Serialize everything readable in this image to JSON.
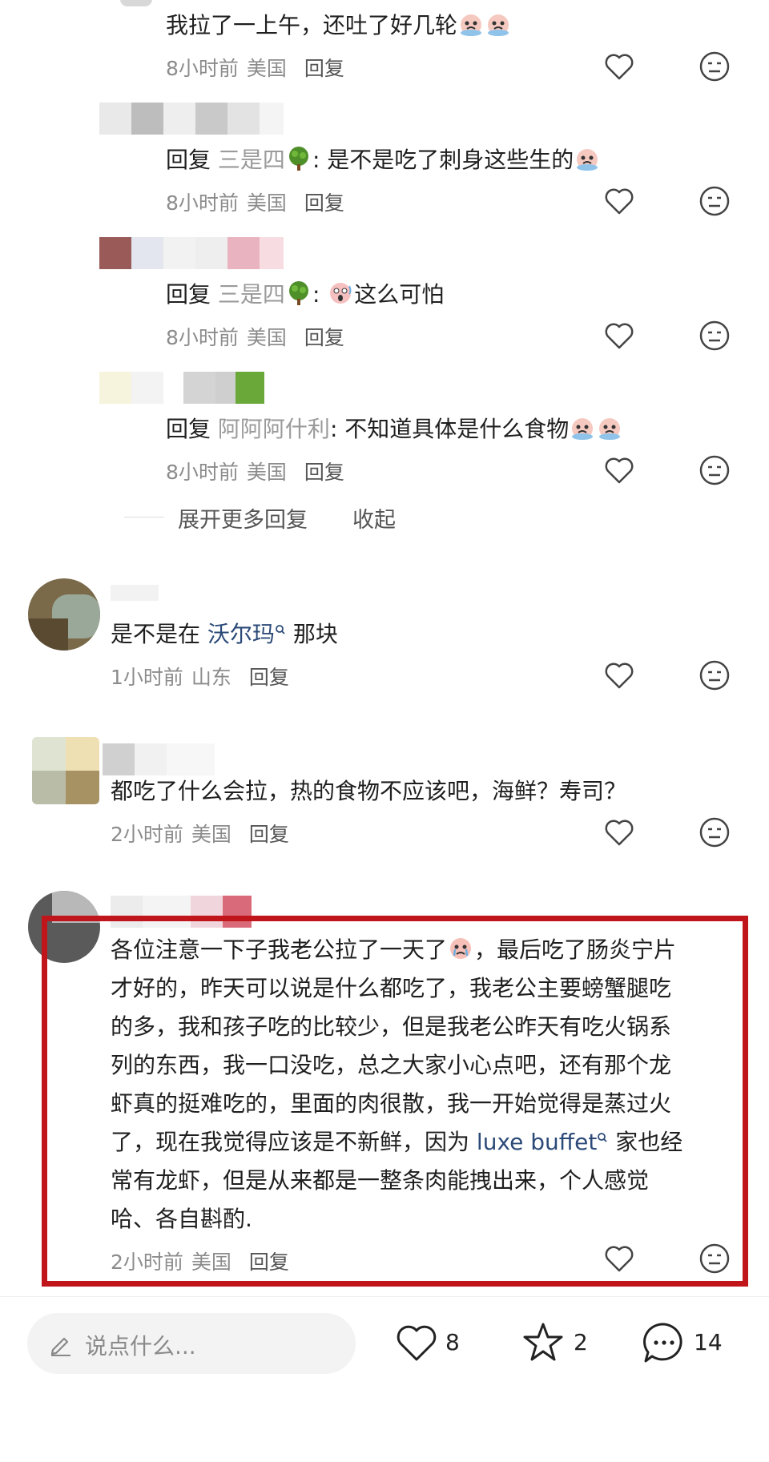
{
  "comments_top": [
    {
      "text": "我拉了一上午，还吐了好几轮",
      "time": "8小时前",
      "location": "美国",
      "reply": "回复"
    },
    {
      "prefix": "回复",
      "reply_to": "三是四",
      "text": ": 是不是吃了刺身这些生的",
      "time": "8小时前",
      "location": "美国",
      "reply": "回复"
    },
    {
      "prefix": "回复",
      "reply_to": "三是四",
      "text": "这么可怕",
      "time": "8小时前",
      "location": "美国",
      "reply": "回复"
    },
    {
      "prefix": "回复",
      "reply_to": "阿阿阿什利",
      "text": ": 不知道具体是什么食物",
      "time": "8小时前",
      "location": "美国",
      "reply": "回复"
    }
  ],
  "expand_more": "展开更多回复",
  "collapse": "收起",
  "comment_walmart": {
    "before": "是不是在",
    "link": "沃尔玛",
    "after": "那块",
    "time": "1小时前",
    "location": "山东",
    "reply": "回复"
  },
  "comment_seafood": {
    "text": "都吃了什么会拉，热的食物不应该吧，海鲜？寿司？",
    "time": "2小时前",
    "location": "美国",
    "reply": "回复"
  },
  "comment_long": {
    "lines": [
      "各位注意一下子我老公拉了一天了",
      "，最后吃了肠炎宁片",
      "才好的，昨天可以说是什么都吃了，我老公主要螃蟹腿吃",
      "的多，我和孩子吃的比较少，但是我老公昨天有吃火锅系",
      "列的东西，我一口没吃，总之大家小心点吧，还有那个龙",
      "虾真的挺难吃的，里面的肉很散，我一开始觉得是蒸过火",
      "了，现在我觉得应该是不新鲜，因为",
      "luxe buffet",
      "家也经",
      "常有龙虾，但是从来都是一整条肉能拽出来，个人感觉",
      "哈、各自斟酌."
    ],
    "time": "2小时前",
    "location": "美国",
    "reply": "回复"
  },
  "bottom_bar": {
    "placeholder": "说点什么...",
    "likes": "8",
    "stars": "2",
    "comments": "14"
  },
  "colors": {
    "highlight": "#c0161b",
    "link": "#2b4a78"
  }
}
